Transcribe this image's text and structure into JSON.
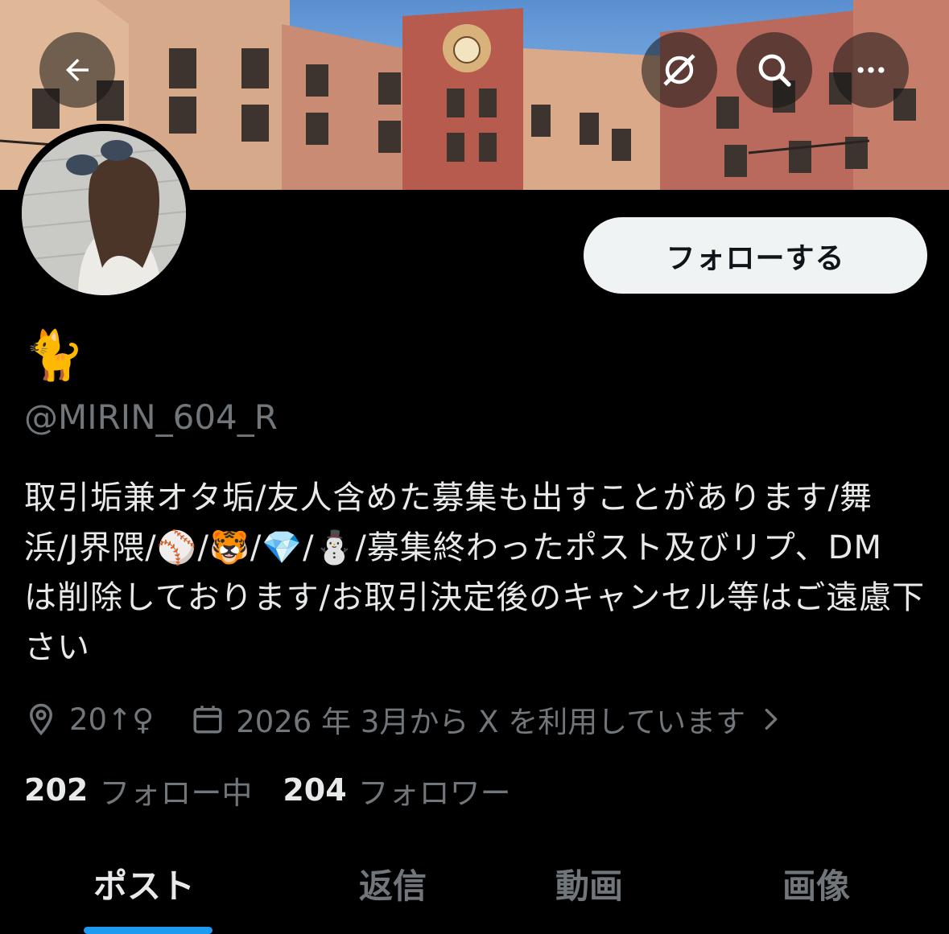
{
  "header": {
    "back_icon": "arrow-left-icon",
    "grok_icon": "grok-icon",
    "search_icon": "search-icon",
    "more_icon": "more-horizontal-icon"
  },
  "profile": {
    "display_name": "🐈",
    "handle": "@MIRIN_604_R",
    "bio": "取引垢兼オタ垢/友人含めた募集も出すことがあります/舞浜/J界隈/⚾️/🐯/💎/⛄️/募集終わったポスト及びリプ、DM は削除しております/お取引決定後のキャンセル等はご遠慮下さい",
    "location": "20↑♀",
    "joined": "2026 年 3月から X を利用しています",
    "following_count": "202",
    "following_label": "フォロー中",
    "followers_count": "204",
    "followers_label": "フォロワー"
  },
  "follow_button": {
    "label": "フォローする"
  },
  "tabs": [
    {
      "label": "ポスト",
      "active": true
    },
    {
      "label": "返信",
      "active": false
    },
    {
      "label": "動画",
      "active": false
    },
    {
      "label": "画像",
      "active": false
    }
  ],
  "colors": {
    "background": "#000000",
    "text_primary": "#e7e9ea",
    "text_secondary": "#71767b",
    "accent": "#1d9bf0",
    "button_bg": "#eff3f4"
  }
}
